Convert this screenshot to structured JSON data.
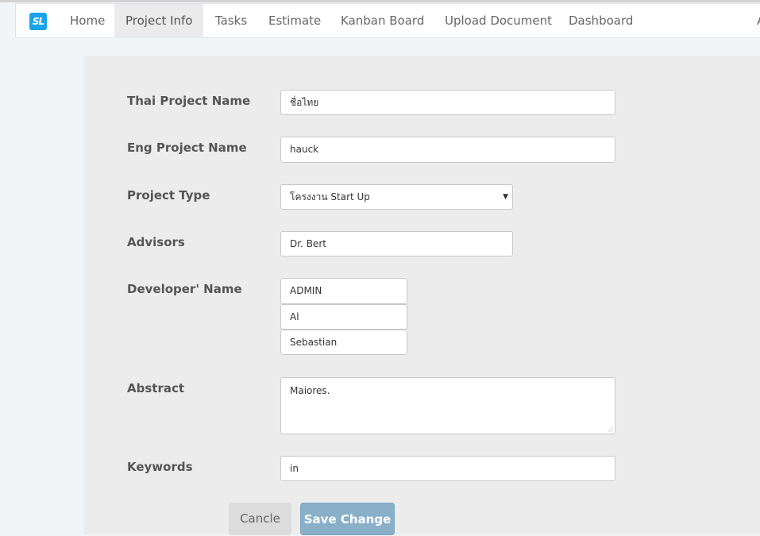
{
  "nav": {
    "logo_text": "SL",
    "items": [
      {
        "label": "Home"
      },
      {
        "label": "Project Info",
        "active": true
      },
      {
        "label": "Tasks"
      },
      {
        "label": "Estimate"
      },
      {
        "label": "Kanban Board"
      },
      {
        "label": "Upload Document"
      },
      {
        "label": "Dashboard"
      }
    ],
    "overflow_label": "A"
  },
  "form": {
    "thai_project_name": {
      "label": "Thai Project Name",
      "value": "ชื่อไทย"
    },
    "eng_project_name": {
      "label": "Eng Project Name",
      "value": "hauck"
    },
    "project_type": {
      "label": "Project Type",
      "selected": "โครงงาน Start Up"
    },
    "advisors": {
      "label": "Advisors",
      "value": "Dr. Bert"
    },
    "developers": {
      "label": "Developer' Name",
      "values": [
        "ADMIN",
        "Al",
        "Sebastian"
      ]
    },
    "abstract": {
      "label": "Abstract",
      "value": "Maiores."
    },
    "keywords": {
      "label": "Keywords",
      "value": "in"
    }
  },
  "actions": {
    "cancel_label": "Cancle",
    "save_label": "Save Change"
  },
  "colors": {
    "brand": "#1aa3e8",
    "save_button": "#8ab0c9",
    "panel_bg": "#ececec"
  }
}
